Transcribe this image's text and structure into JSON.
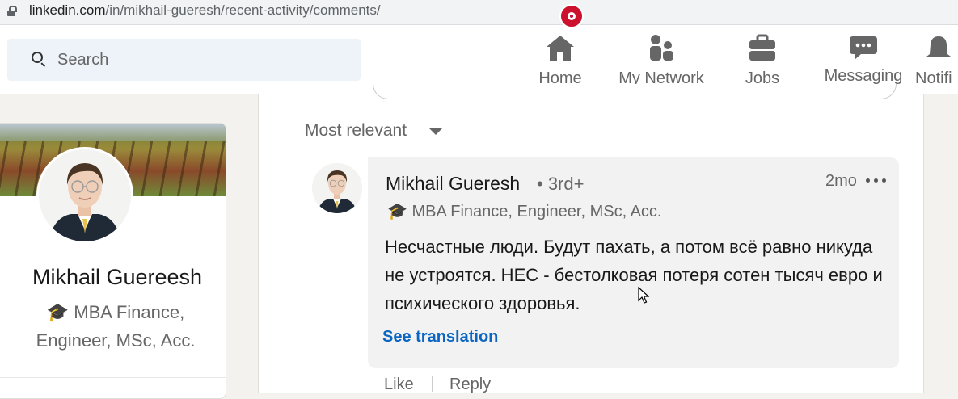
{
  "browser": {
    "url_host": "linkedin.com",
    "url_path": "/in/mikhail-gueresh/recent-activity/comments/"
  },
  "nav": {
    "search_placeholder": "Search",
    "items": [
      {
        "label": "Home",
        "icon": "home-icon",
        "has_badge": true
      },
      {
        "label": "My Network",
        "icon": "network-icon"
      },
      {
        "label": "Jobs",
        "icon": "briefcase-icon"
      },
      {
        "label": "Messaging",
        "icon": "messaging-icon"
      },
      {
        "label": "Notifi",
        "icon": "bell-icon"
      }
    ],
    "badge_color": "#cb112d"
  },
  "profile": {
    "name": "Mikhail Guereesh",
    "headline_line1": "🎓 MBA Finance,",
    "headline_line2": "Engineer, MSc, Acc."
  },
  "comments": {
    "sort_label": "Most relevant",
    "items": [
      {
        "author": "Mikhail Gueresh",
        "degree": "• 3rd+",
        "time": "2mo",
        "headline": "🎓 MBA Finance, Engineer, MSc, Acc.",
        "text": "Несчастные люди. Будут пахать, а потом всё равно никуда не устроятся. НЕС - бестолковая потеря сотен тысяч евро и психического здоровья.",
        "translate_label": "See translation",
        "like_label": "Like",
        "reply_label": "Reply"
      }
    ]
  },
  "colors": {
    "link": "#0a66c2",
    "page_bg": "#f4f2ee",
    "bubble_bg": "#f2f2f2"
  }
}
